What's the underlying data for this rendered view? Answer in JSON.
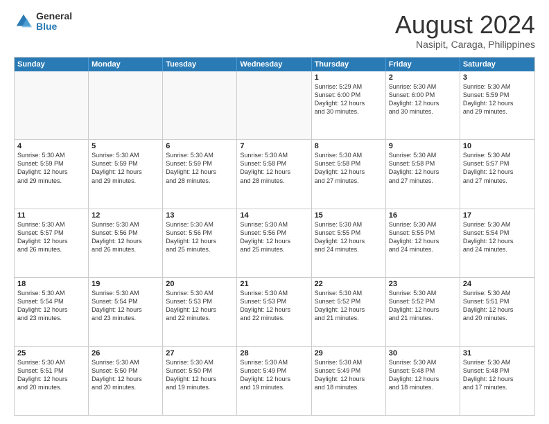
{
  "logo": {
    "general": "General",
    "blue": "Blue"
  },
  "title": "August 2024",
  "location": "Nasipit, Caraga, Philippines",
  "days": [
    "Sunday",
    "Monday",
    "Tuesday",
    "Wednesday",
    "Thursday",
    "Friday",
    "Saturday"
  ],
  "weeks": [
    [
      {
        "day": "",
        "text": ""
      },
      {
        "day": "",
        "text": ""
      },
      {
        "day": "",
        "text": ""
      },
      {
        "day": "",
        "text": ""
      },
      {
        "day": "1",
        "text": "Sunrise: 5:29 AM\nSunset: 6:00 PM\nDaylight: 12 hours\nand 30 minutes."
      },
      {
        "day": "2",
        "text": "Sunrise: 5:30 AM\nSunset: 6:00 PM\nDaylight: 12 hours\nand 30 minutes."
      },
      {
        "day": "3",
        "text": "Sunrise: 5:30 AM\nSunset: 5:59 PM\nDaylight: 12 hours\nand 29 minutes."
      }
    ],
    [
      {
        "day": "4",
        "text": "Sunrise: 5:30 AM\nSunset: 5:59 PM\nDaylight: 12 hours\nand 29 minutes."
      },
      {
        "day": "5",
        "text": "Sunrise: 5:30 AM\nSunset: 5:59 PM\nDaylight: 12 hours\nand 29 minutes."
      },
      {
        "day": "6",
        "text": "Sunrise: 5:30 AM\nSunset: 5:59 PM\nDaylight: 12 hours\nand 28 minutes."
      },
      {
        "day": "7",
        "text": "Sunrise: 5:30 AM\nSunset: 5:58 PM\nDaylight: 12 hours\nand 28 minutes."
      },
      {
        "day": "8",
        "text": "Sunrise: 5:30 AM\nSunset: 5:58 PM\nDaylight: 12 hours\nand 27 minutes."
      },
      {
        "day": "9",
        "text": "Sunrise: 5:30 AM\nSunset: 5:58 PM\nDaylight: 12 hours\nand 27 minutes."
      },
      {
        "day": "10",
        "text": "Sunrise: 5:30 AM\nSunset: 5:57 PM\nDaylight: 12 hours\nand 27 minutes."
      }
    ],
    [
      {
        "day": "11",
        "text": "Sunrise: 5:30 AM\nSunset: 5:57 PM\nDaylight: 12 hours\nand 26 minutes."
      },
      {
        "day": "12",
        "text": "Sunrise: 5:30 AM\nSunset: 5:56 PM\nDaylight: 12 hours\nand 26 minutes."
      },
      {
        "day": "13",
        "text": "Sunrise: 5:30 AM\nSunset: 5:56 PM\nDaylight: 12 hours\nand 25 minutes."
      },
      {
        "day": "14",
        "text": "Sunrise: 5:30 AM\nSunset: 5:56 PM\nDaylight: 12 hours\nand 25 minutes."
      },
      {
        "day": "15",
        "text": "Sunrise: 5:30 AM\nSunset: 5:55 PM\nDaylight: 12 hours\nand 24 minutes."
      },
      {
        "day": "16",
        "text": "Sunrise: 5:30 AM\nSunset: 5:55 PM\nDaylight: 12 hours\nand 24 minutes."
      },
      {
        "day": "17",
        "text": "Sunrise: 5:30 AM\nSunset: 5:54 PM\nDaylight: 12 hours\nand 24 minutes."
      }
    ],
    [
      {
        "day": "18",
        "text": "Sunrise: 5:30 AM\nSunset: 5:54 PM\nDaylight: 12 hours\nand 23 minutes."
      },
      {
        "day": "19",
        "text": "Sunrise: 5:30 AM\nSunset: 5:54 PM\nDaylight: 12 hours\nand 23 minutes."
      },
      {
        "day": "20",
        "text": "Sunrise: 5:30 AM\nSunset: 5:53 PM\nDaylight: 12 hours\nand 22 minutes."
      },
      {
        "day": "21",
        "text": "Sunrise: 5:30 AM\nSunset: 5:53 PM\nDaylight: 12 hours\nand 22 minutes."
      },
      {
        "day": "22",
        "text": "Sunrise: 5:30 AM\nSunset: 5:52 PM\nDaylight: 12 hours\nand 21 minutes."
      },
      {
        "day": "23",
        "text": "Sunrise: 5:30 AM\nSunset: 5:52 PM\nDaylight: 12 hours\nand 21 minutes."
      },
      {
        "day": "24",
        "text": "Sunrise: 5:30 AM\nSunset: 5:51 PM\nDaylight: 12 hours\nand 20 minutes."
      }
    ],
    [
      {
        "day": "25",
        "text": "Sunrise: 5:30 AM\nSunset: 5:51 PM\nDaylight: 12 hours\nand 20 minutes."
      },
      {
        "day": "26",
        "text": "Sunrise: 5:30 AM\nSunset: 5:50 PM\nDaylight: 12 hours\nand 20 minutes."
      },
      {
        "day": "27",
        "text": "Sunrise: 5:30 AM\nSunset: 5:50 PM\nDaylight: 12 hours\nand 19 minutes."
      },
      {
        "day": "28",
        "text": "Sunrise: 5:30 AM\nSunset: 5:49 PM\nDaylight: 12 hours\nand 19 minutes."
      },
      {
        "day": "29",
        "text": "Sunrise: 5:30 AM\nSunset: 5:49 PM\nDaylight: 12 hours\nand 18 minutes."
      },
      {
        "day": "30",
        "text": "Sunrise: 5:30 AM\nSunset: 5:48 PM\nDaylight: 12 hours\nand 18 minutes."
      },
      {
        "day": "31",
        "text": "Sunrise: 5:30 AM\nSunset: 5:48 PM\nDaylight: 12 hours\nand 17 minutes."
      }
    ]
  ]
}
